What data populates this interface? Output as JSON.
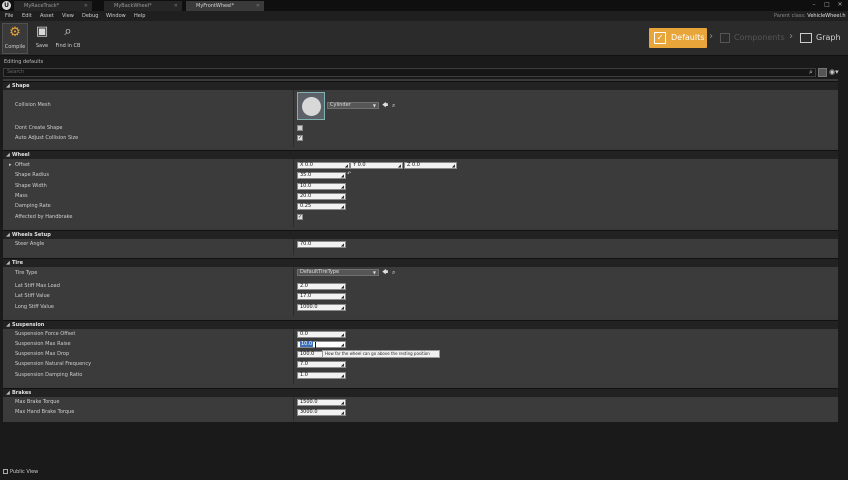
{
  "tabs": [
    {
      "label": "MyRaceTrack*",
      "active": false
    },
    {
      "label": "MyBackWheel*",
      "active": false
    },
    {
      "label": "MyFrontWheel*",
      "active": true
    }
  ],
  "menu": [
    "File",
    "Edit",
    "Asset",
    "View",
    "Debug",
    "Window",
    "Help"
  ],
  "parent_class": {
    "label": "Parent class:",
    "value": "VehicleWheel.h"
  },
  "toolbar": {
    "compile": "Compile",
    "save": "Save",
    "find_in_cb": "Find in CB"
  },
  "modes": {
    "defaults": "Defaults",
    "components": "Components",
    "graph": "Graph"
  },
  "editing_label": "Editing defaults",
  "search": {
    "placeholder": "Search"
  },
  "shape": {
    "title": "Shape",
    "collision_mesh": "Collision Mesh",
    "mesh_value": "Cylinder",
    "dont_create_shape": "Dont Create Shape",
    "dont_create_shape_checked": false,
    "auto_adjust": "Auto Adjust Collision Size",
    "auto_adjust_checked": true
  },
  "wheel": {
    "title": "Wheel",
    "offset": "Offset",
    "offset_x": "X  0.0",
    "offset_y": "Y  0.0",
    "offset_z": "Z  0.0",
    "shape_radius": "Shape Radius",
    "shape_radius_value": "35.0",
    "shape_width": "Shape Width",
    "shape_width_value": "10.0",
    "mass": "Mass",
    "mass_value": "20.0",
    "damping_rate": "Damping Rate",
    "damping_rate_value": "0.25",
    "affected_handbrake": "Affected by Handbrake",
    "affected_handbrake_checked": true
  },
  "wheels_setup": {
    "title": "Wheels Setup",
    "steer_angle": "Steer Angle",
    "steer_angle_value": "70.0"
  },
  "tire": {
    "title": "Tire",
    "tire_type": "Tire Type",
    "tire_type_value": "DefaultTireType",
    "lat_stiff_max_load": "Lat Stiff Max Load",
    "lat_stiff_max_load_value": "2.0",
    "lat_stiff_value": "Lat Stiff Value",
    "lat_stiff_value_value": "17.0",
    "long_stiff_value": "Long Stiff Value",
    "long_stiff_value_value": "1000.0"
  },
  "suspension": {
    "title": "Suspension",
    "force_offset": "Suspension Force Offset",
    "force_offset_value": "0.0",
    "max_raise": "Suspension Max Raise",
    "max_raise_value": "10.0",
    "max_drop": "Suspension Max Drop",
    "max_drop_value": "100.0",
    "natural_frequency": "Suspension Natural Frequency",
    "natural_frequency_value": "7.0",
    "damping_ratio": "Suspension Damping Ratio",
    "damping_ratio_value": "1.0",
    "tooltip": "How far the wheel can go above the resting position"
  },
  "brakes": {
    "title": "Brakes",
    "max_brake_torque": "Max Brake Torque",
    "max_brake_torque_value": "1500.0",
    "max_hand_brake_torque": "Max Hand Brake Torque",
    "max_hand_brake_torque_value": "3000.0"
  },
  "bottom": {
    "public_view": "Public View"
  }
}
